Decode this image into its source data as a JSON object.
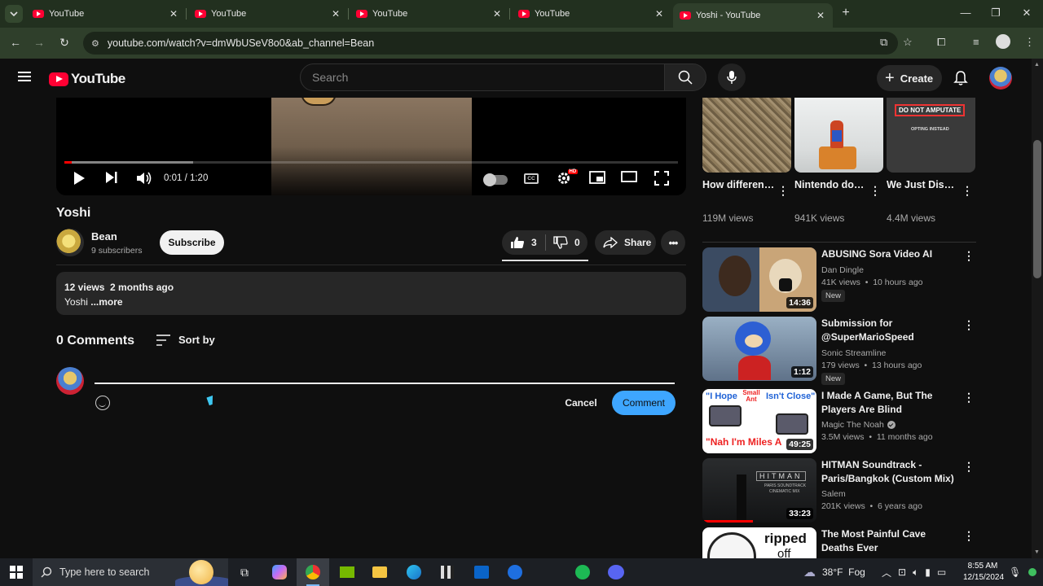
{
  "browser": {
    "tabs": [
      {
        "label": "YouTube",
        "active": false
      },
      {
        "label": "YouTube",
        "active": false
      },
      {
        "label": "YouTube",
        "active": false
      },
      {
        "label": "YouTube",
        "active": false
      },
      {
        "label": "Yoshi - YouTube",
        "active": true
      }
    ],
    "url": "youtube.com/watch?v=dmWbUSeV8o0&ab_channel=Bean"
  },
  "masthead": {
    "logo": "YouTube",
    "search_placeholder": "Search",
    "create_label": "Create"
  },
  "player": {
    "time": "0:01 / 1:20",
    "progress": 0.0125,
    "buffered": 0.21
  },
  "video": {
    "title": "Yoshi",
    "channel": "Bean",
    "subscribers": "9 subscribers",
    "subscribe_label": "Subscribe",
    "likes": "3",
    "dislikes": "0",
    "share_label": "Share",
    "stats": "12 views  2 months ago",
    "description": "Yoshi",
    "more_label": " ...more"
  },
  "comments": {
    "count_label": "0 Comments",
    "sort_label": "Sort by",
    "input_value": "",
    "cancel_label": "Cancel",
    "comment_label": "Comment"
  },
  "shorts": [
    {
      "title": "How different ...",
      "views": "119M views"
    },
    {
      "title": "Nintendo doesn't wa...",
      "views": "941K views"
    },
    {
      "title": "We Just Discovered ...",
      "views": "4.4M views",
      "thumb_text": "DO NOT AMPUTATE",
      "thumb_sub": "OPTING INSTEAD"
    }
  ],
  "recommendations": [
    {
      "title": "ABUSING Sora Video AI",
      "channel": "Dan Dingle",
      "verified": false,
      "meta": "41K views  •  10 hours ago",
      "badge": "New",
      "duration": "14:36"
    },
    {
      "title": "Submission for @SuperMarioSpeed",
      "channel": "Sonic Streamline",
      "verified": false,
      "meta": "179 views  •  13 hours ago",
      "badge": "New",
      "duration": "1:12"
    },
    {
      "title": "I Made A Game, But The Players Are Blind",
      "channel": "Magic The Noah",
      "verified": true,
      "meta": "3.5M views  •  11 months ago",
      "badge": "",
      "duration": "49:25",
      "thumb_text": [
        "\"I Hope",
        "Small Ant",
        "Isn't Close\"",
        "\"Nah I'm Miles A"
      ]
    },
    {
      "title": "HITMAN Soundtrack - Paris/Bangkok (Custom Mix)",
      "channel": "Salem",
      "verified": false,
      "meta": "201K views  •  6 years ago",
      "badge": "",
      "duration": "33:23",
      "thumb_text": [
        "HITMAN",
        "PARIS SOUNDTRACK",
        "CINEMATIC MIX"
      ]
    },
    {
      "title": "The Most Painful Cave Deaths Ever",
      "channel": "",
      "verified": false,
      "meta": "",
      "badge": "",
      "duration": "",
      "thumb_text": [
        "ripped",
        "off"
      ]
    }
  ],
  "taskbar": {
    "search_placeholder": "Type here to search",
    "weather": "38°F  Fog",
    "time": "8:55 AM",
    "date": "12/15/2024"
  }
}
